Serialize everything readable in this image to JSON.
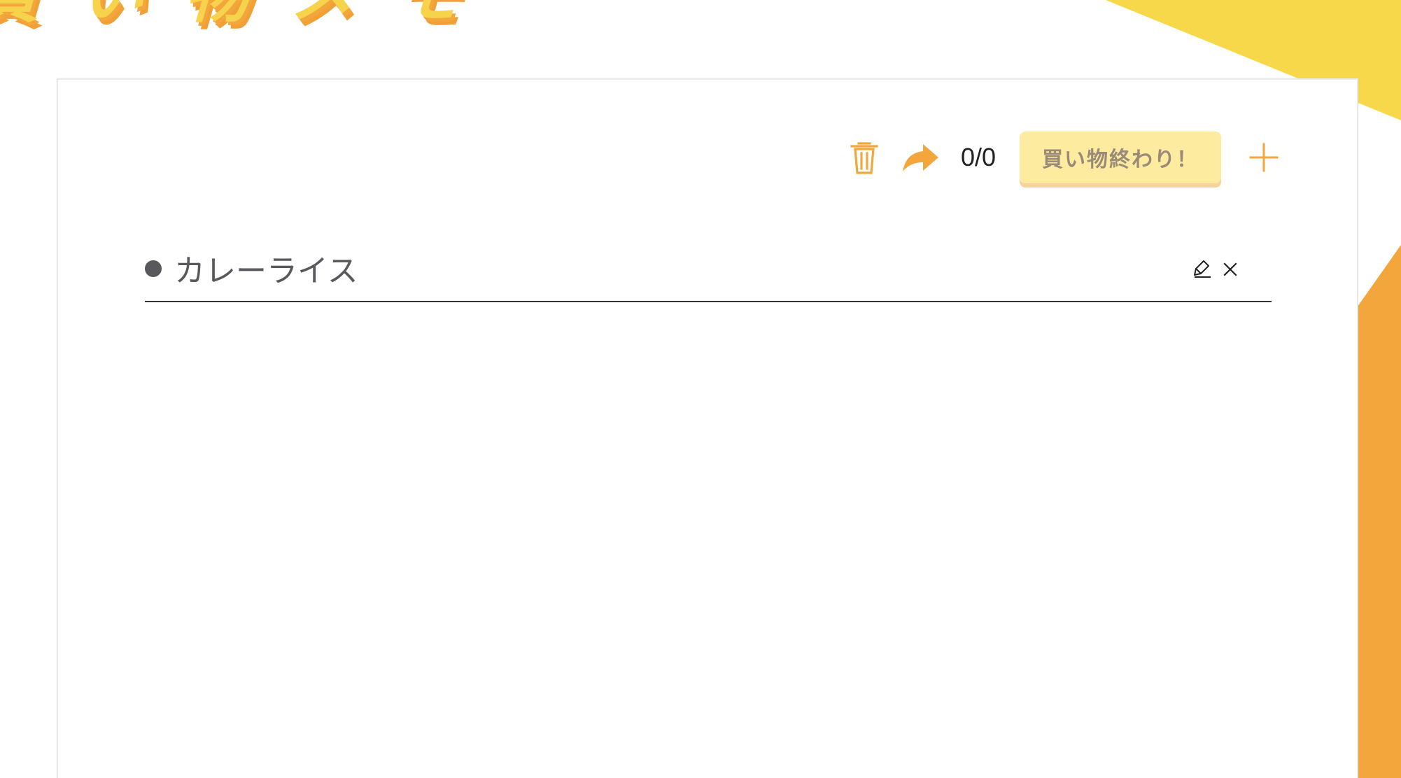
{
  "app": {
    "title_art": "買い物メモ"
  },
  "toolbar": {
    "trash_icon": "trash-icon",
    "share_icon": "share-icon",
    "progress_text": "0/0",
    "finish_label": "買い物終わり！",
    "add_icon": "plus-icon"
  },
  "items": [
    {
      "label": "カレーライス",
      "edit_icon": "pencil-icon",
      "delete_icon": "close-icon"
    }
  ],
  "colors": {
    "yellow": "#f8d84b",
    "orange": "#f2a63b",
    "button_bg": "#fdeb9f",
    "button_text": "#9a8a78",
    "item_text": "#58585d"
  }
}
